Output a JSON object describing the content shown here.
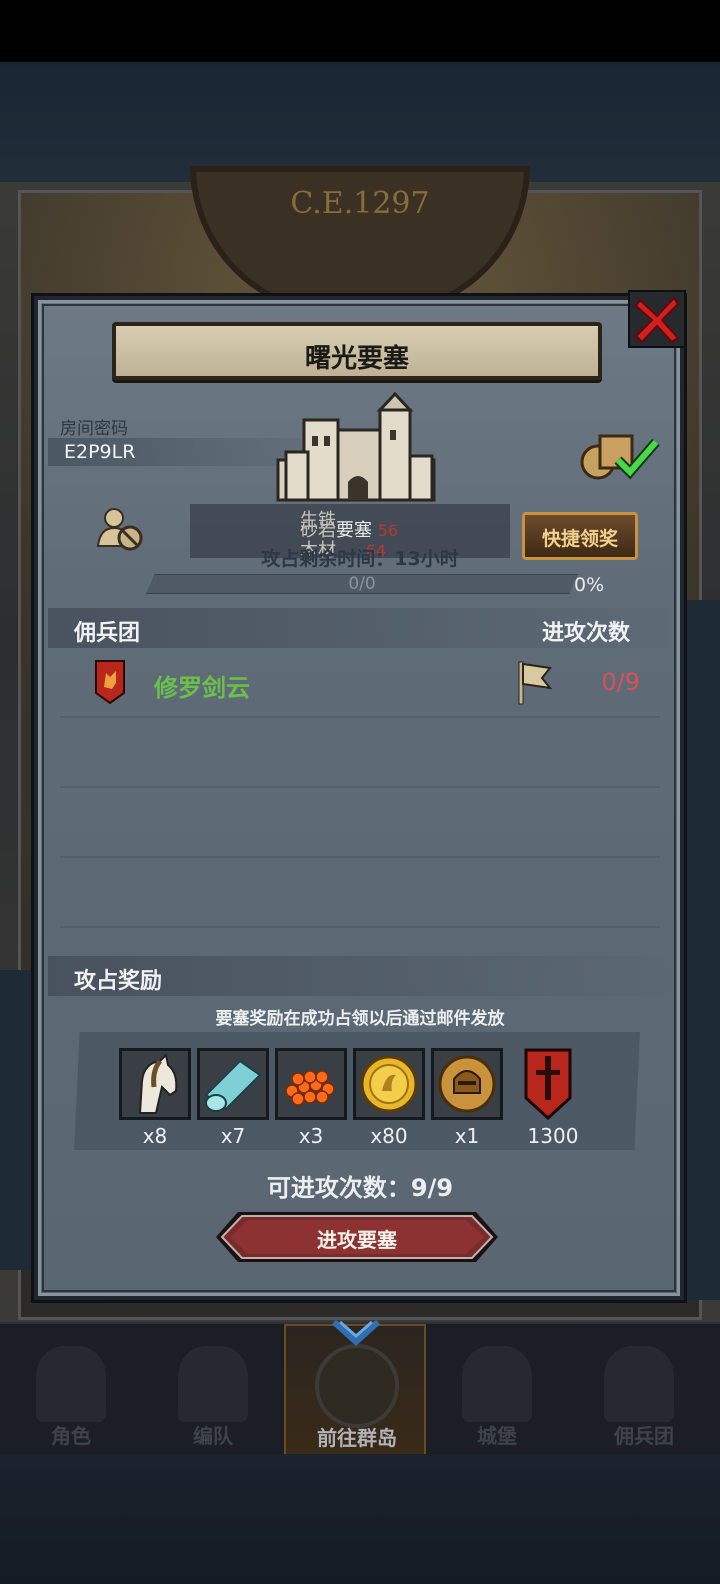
{
  "header": {
    "year": "C.E.1297"
  },
  "dialog": {
    "title": "曙光要塞",
    "room_label": "房间密码",
    "room_code": "E2P9LR",
    "resources": [
      {
        "name": "生铁",
        "value": ""
      },
      {
        "name": "砂岩",
        "value": "56"
      },
      {
        "name": "木材",
        "value": "64"
      }
    ],
    "fortress_label": "要塞",
    "occupy_time": "攻占剩余时间：13小时",
    "claim_button": "快捷领奖",
    "progress": {
      "text": "0/0",
      "percent_label": "0%",
      "fraction": 0
    },
    "mercenary_header": "佣兵团",
    "attack_count_header": "进攻次数",
    "mercenaries": [
      {
        "name": "修罗剑云",
        "attacks": "0/9"
      }
    ],
    "reward_header": "攻占奖励",
    "reward_note": "要塞奖励在成功占领以后通过邮件发放",
    "rewards": [
      {
        "icon": "horse-icon",
        "qty": "x8"
      },
      {
        "icon": "cloth-roll-icon",
        "qty": "x7"
      },
      {
        "icon": "orange-beads-icon",
        "qty": "x3"
      },
      {
        "icon": "gold-coin-icon",
        "qty": "x80"
      },
      {
        "icon": "helmet-coin-icon",
        "qty": "x1"
      },
      {
        "icon": "sword-banner-icon",
        "qty": "1300"
      }
    ],
    "attempts_text": "可进攻次数：9/9",
    "attack_button": "进攻要塞"
  },
  "nav": {
    "items": [
      {
        "label": "角色",
        "icon": "knight-icon"
      },
      {
        "label": "编队",
        "icon": "helmet-icon"
      },
      {
        "label": "前往群岛",
        "icon": "compass-icon"
      },
      {
        "label": "城堡",
        "icon": "castle-icon"
      },
      {
        "label": "佣兵团",
        "icon": "warrior-icon"
      }
    ],
    "active_index": 2
  },
  "colors": {
    "accent_gold": "#c9923d",
    "merc_name_green": "#6ac04a",
    "attack_count_red": "#d8505a",
    "close_red": "#d21e1e"
  }
}
